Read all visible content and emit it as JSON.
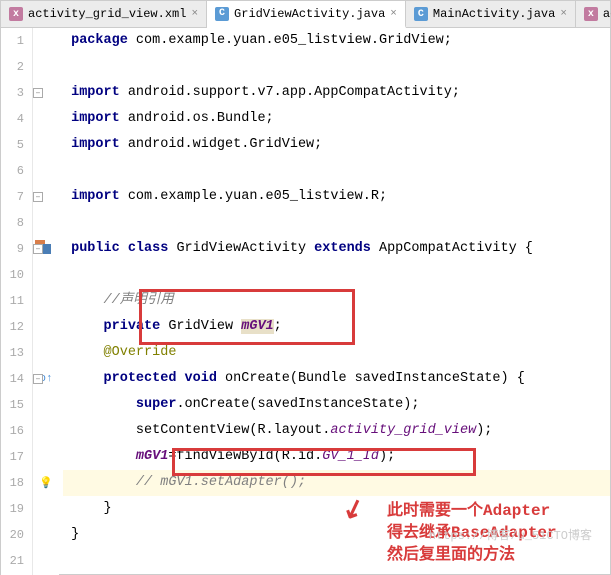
{
  "tabs": [
    {
      "icon": "xml",
      "label": "activity_grid_view.xml",
      "active": false
    },
    {
      "icon": "java",
      "label": "GridViewActivity.java",
      "active": true
    },
    {
      "icon": "java",
      "label": "MainActivity.java",
      "active": false
    },
    {
      "icon": "xml",
      "label": "activity_main.xml",
      "active": false
    }
  ],
  "lines": [
    "1",
    "2",
    "3",
    "4",
    "5",
    "6",
    "7",
    "8",
    "9",
    "10",
    "11",
    "12",
    "13",
    "14",
    "15",
    "16",
    "17",
    "18",
    "19",
    "20",
    "21"
  ],
  "code": {
    "pkg_kw": "package",
    "pkg": " com.example.yuan.e05_listview.GridView;",
    "imp_kw": "import",
    "imp1": " android.support.v7.app.AppCompatActivity;",
    "imp2": " android.os.Bundle;",
    "imp3": " android.widget.GridView;",
    "imp4": " com.example.yuan.e05_listview.R;",
    "pub": "public ",
    "cls": "class ",
    "cname": "GridViewActivity ",
    "ext": "extends ",
    "sup": "AppCompatActivity {",
    "c1": "//声明引用",
    "priv": "private ",
    "gtype": "GridView ",
    "fld": "mGV1",
    "semi": ";",
    "ovr": "@Override",
    "prot": "protected ",
    "vd": "void ",
    "mname": "onCreate",
    "args": "(Bundle savedInstanceState) {",
    "sup1": "super",
    "sup2": ".onCreate(savedInstanceState);",
    "scv": "setContentView(R.layout.",
    "lay": "activity_grid_view",
    "p1": ");",
    "asg": "=findViewById(R.id.",
    "rid": "GV_1_Id",
    "p2": ");",
    "c2": "// mGV1.setAdapter();",
    "rb1": "}",
    "rb2": "}"
  },
  "annotation": {
    "l1": "此时需要一个Adapter",
    "l2": "得去继承BaseAdapter",
    "l3": "然后复里面的方法"
  },
  "watermark": "https://博客/u_51CTO博客"
}
